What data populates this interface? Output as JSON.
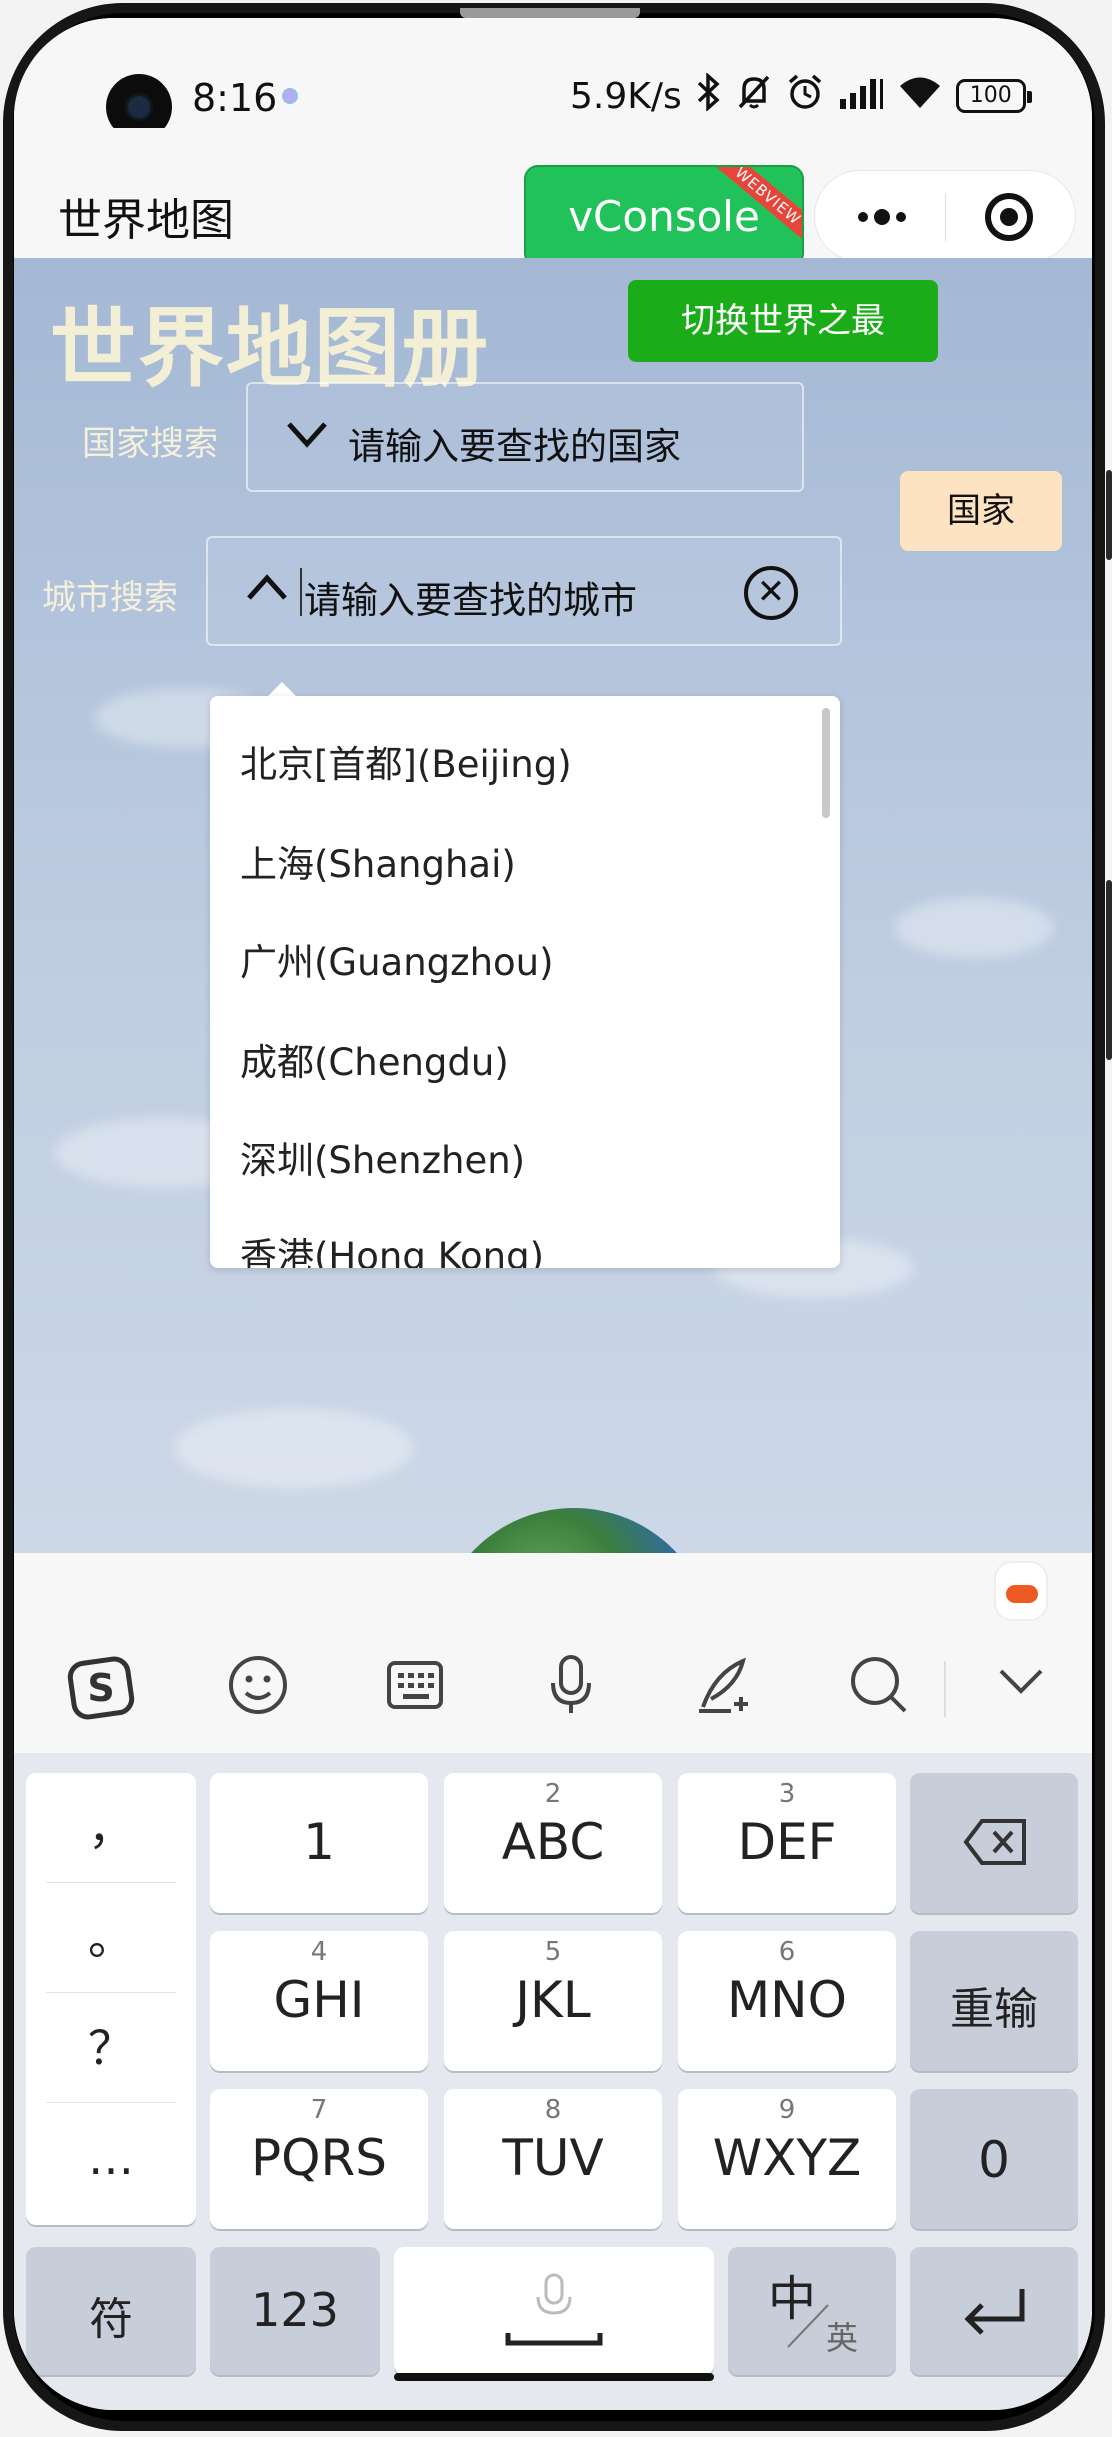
{
  "status_bar": {
    "time": "8:16",
    "net_speed": "5.9K/s",
    "battery": "100"
  },
  "nav": {
    "title": "世界地图",
    "vconsole_label": "vConsole",
    "webview_tag": "WEBVIEW"
  },
  "page": {
    "atlas_title": "世界地图册",
    "switch_button": "切换世界之最",
    "country_search_label": "国家搜索",
    "country_search_placeholder": "请输入要查找的国家",
    "city_search_label": "城市搜索",
    "city_search_placeholder": "请输入要查找的城市",
    "country_tab": "国家"
  },
  "city_dropdown": {
    "items": [
      "北京[首都](Beijing)",
      "上海(Shanghai)",
      "广州(Guangzhou)",
      "成都(Chengdu)",
      "深圳(Shenzhen)",
      "香港(Hong Kong)"
    ]
  },
  "keyboard": {
    "punctuation": [
      "，",
      "。",
      "？",
      "…"
    ],
    "keys_row1": [
      {
        "sup": "",
        "main": "1"
      },
      {
        "sup": "2",
        "main": "ABC"
      },
      {
        "sup": "3",
        "main": "DEF"
      }
    ],
    "keys_row2": [
      {
        "sup": "4",
        "main": "GHI"
      },
      {
        "sup": "5",
        "main": "JKL"
      },
      {
        "sup": "6",
        "main": "MNO"
      }
    ],
    "keys_row3": [
      {
        "sup": "7",
        "main": "PQRS"
      },
      {
        "sup": "8",
        "main": "TUV"
      },
      {
        "sup": "9",
        "main": "WXYZ"
      }
    ],
    "reset": "重输",
    "zero": "0",
    "symbols": "符",
    "numbers": "123",
    "lang_main": "中",
    "lang_sub": "英"
  }
}
